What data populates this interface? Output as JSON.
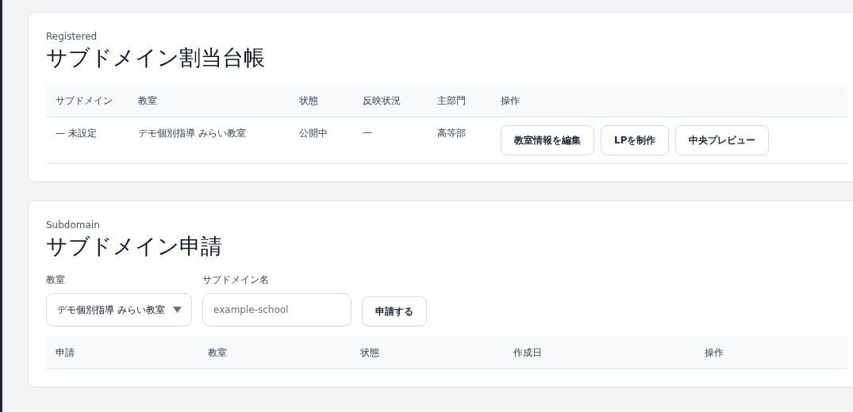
{
  "registered": {
    "eyebrow": "Registered",
    "title": "サブドメイン割当台帳",
    "columns": [
      "サブドメイン",
      "教室",
      "状態",
      "反映状況",
      "主部門",
      "操作"
    ],
    "rows": [
      {
        "cells": [
          "— 未設定",
          "デモ個別指導 みらい教室",
          "公開中",
          "—",
          "高等部"
        ],
        "actions": [
          "教室情報を編集",
          "LPを制作",
          "中央プレビュー"
        ]
      }
    ]
  },
  "request": {
    "eyebrow": "Subdomain",
    "title": "サブドメイン申請",
    "classroom_field": {
      "label": "教室",
      "value": "デモ個別指導 みらい教室"
    },
    "name_field": {
      "label": "サブドメイン名",
      "placeholder": "example-school"
    },
    "submit": "申請する",
    "columns": [
      "申請",
      "教室",
      "状態",
      "作成日",
      "操作"
    ]
  }
}
